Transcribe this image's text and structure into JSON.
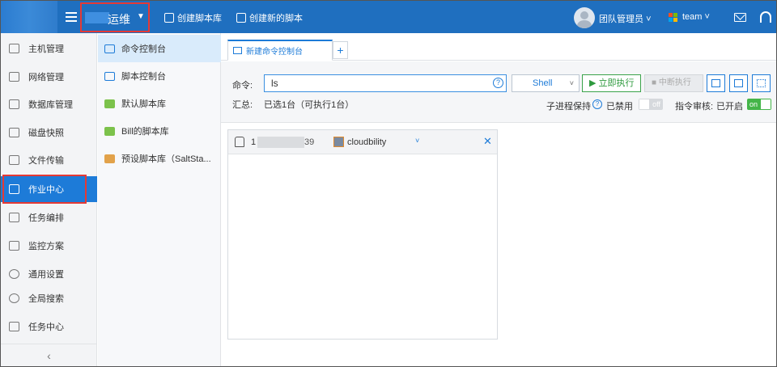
{
  "topbar": {
    "project_name": "运维",
    "create_library": "创建脚本库",
    "create_script": "创建新的脚本",
    "user_role": "团队管理员",
    "team_name": "team",
    "team_logo_colors": [
      "#f25022",
      "#7fba00",
      "#00a4ef",
      "#ffb900"
    ]
  },
  "leftnav": {
    "items": [
      {
        "label": "主机管理",
        "icon": "monitor-icon"
      },
      {
        "label": "网络管理",
        "icon": "network-icon"
      },
      {
        "label": "数据库管理",
        "icon": "database-icon"
      },
      {
        "label": "磁盘快照",
        "icon": "disk-icon"
      },
      {
        "label": "文件传输",
        "icon": "file-transfer-icon"
      },
      {
        "label": "作业中心",
        "icon": "job-icon",
        "active": true
      },
      {
        "label": "任务编排",
        "icon": "task-icon"
      },
      {
        "label": "监控方案",
        "icon": "monitor-chart-icon"
      },
      {
        "label": "通用设置",
        "icon": "gear-icon"
      },
      {
        "label": "全局搜索",
        "icon": "search-icon"
      },
      {
        "label": "任务中心",
        "icon": "task-center-icon"
      }
    ],
    "collapse_glyph": "‹"
  },
  "subnav": {
    "items": [
      {
        "label": "命令控制台",
        "icon": "terminal-icon",
        "active": true
      },
      {
        "label": "脚本控制台",
        "icon": "script-icon"
      },
      {
        "label": "默认脚本库",
        "icon": "database-green-icon"
      },
      {
        "label": "Bill的脚本库",
        "icon": "database-green-icon"
      },
      {
        "label": "预设脚本库（SaltSta...",
        "icon": "database-orange-icon"
      }
    ]
  },
  "tabs": {
    "active_label": "新建命令控制台",
    "add_glyph": "+"
  },
  "command": {
    "label": "命令:",
    "value": "ls",
    "help_glyph": "?",
    "shell_value": "Shell",
    "run_label": "▶ 立即执行",
    "stop_label": "■ 中断执行",
    "summary_label": "汇总:",
    "summary_value": "已选1台（可执行1台）",
    "subprocess_label": "子进程保持",
    "subprocess_status": "已禁用",
    "subprocess_toggle": "off",
    "audit_label": "指令审核:",
    "audit_status": "已开启",
    "audit_toggle": "on"
  },
  "terminal": {
    "ip_lead": "1",
    "ip_tail": "39",
    "host_name": "cloudbility",
    "close_glyph": "✕"
  },
  "colors": {
    "brand_blue": "#1f6fbf",
    "accent_blue": "#1d7bd8",
    "run_green": "#2e9a3e",
    "highlight_red": "#e53935"
  }
}
